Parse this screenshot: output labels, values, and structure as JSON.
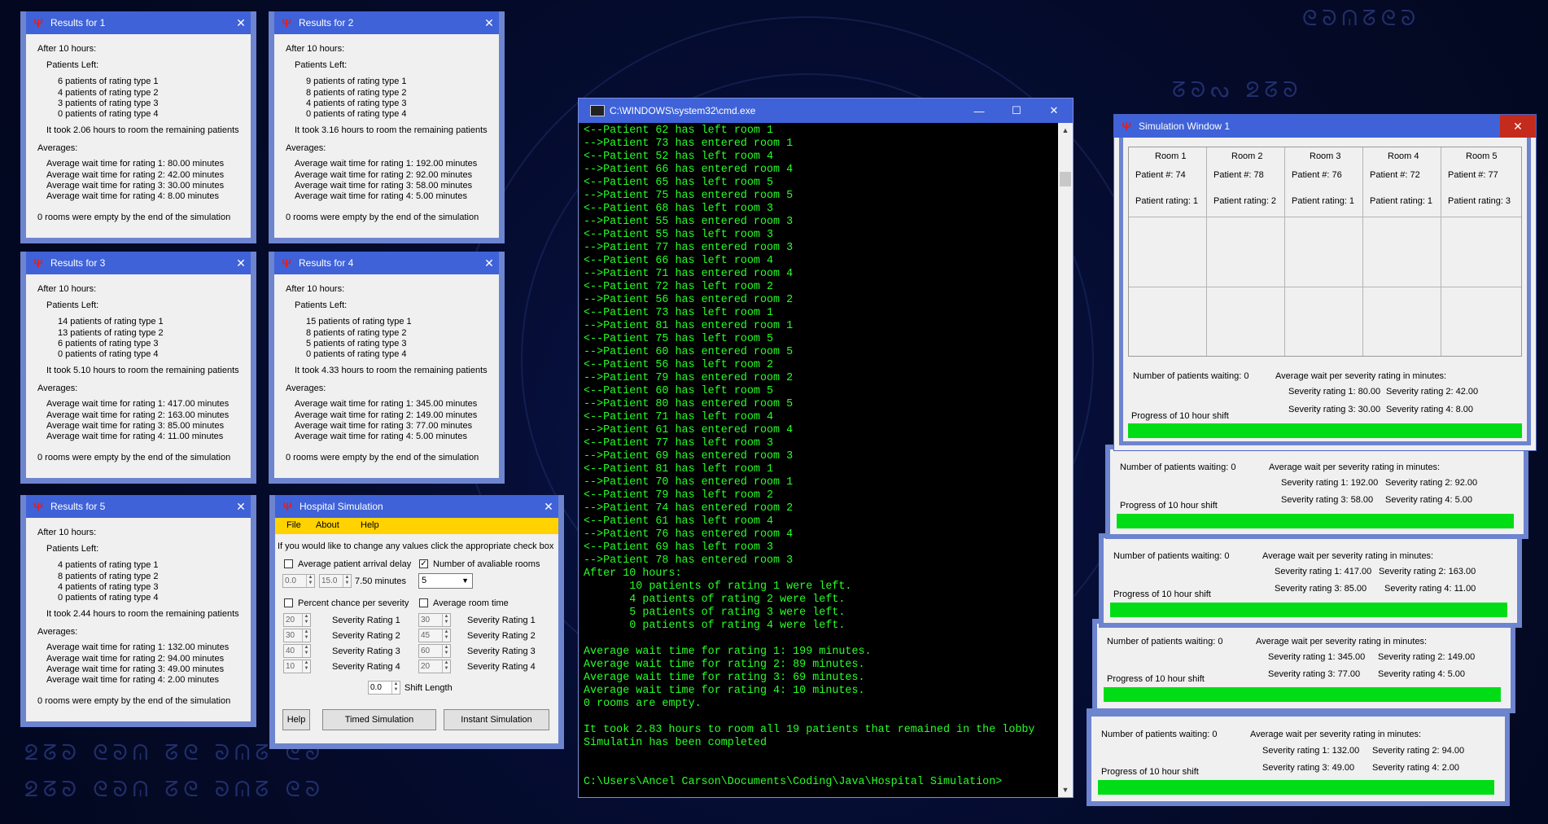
{
  "background": {
    "deco_top": "ᘓᘐᕬᘔᘓᘐ",
    "deco_right": "ᘔᘐᔓ ᘖᘔᘐ",
    "deco_bottom": "ᘖᘔᘐ ᘓᘐᕬ ᘔᘓ ᘐᕬᘔ ᘓᘐ"
  },
  "results": [
    {
      "title": "Results for 1",
      "after": "After 10 hours:",
      "patients_left_label": "Patients Left:",
      "left": [
        "6 patients of rating type 1",
        "4 patients of rating type 2",
        "3 patients of rating type 3",
        "0 patients of rating type 4"
      ],
      "took": "It took 2.06 hours to room the remaining patients",
      "averages_label": "Averages:",
      "averages": [
        "Average wait time for rating 1: 80.00 minutes",
        "Average wait time for rating 2: 42.00 minutes",
        "Average wait time for rating 3: 30.00 minutes",
        "Average wait time for rating 4: 8.00 minutes"
      ],
      "empty": "0 rooms were empty by the end of the simulation"
    },
    {
      "title": "Results for 2",
      "after": "After 10 hours:",
      "patients_left_label": "Patients Left:",
      "left": [
        "9 patients of rating type 1",
        "8 patients of rating type 2",
        "4 patients of rating type 3",
        "0 patients of rating type 4"
      ],
      "took": "It took 3.16 hours to room the remaining patients",
      "averages_label": "Averages:",
      "averages": [
        "Average wait time for rating 1: 192.00 minutes",
        "Average wait time for rating 2: 92.00 minutes",
        "Average wait time for rating 3: 58.00 minutes",
        "Average wait time for rating 4: 5.00 minutes"
      ],
      "empty": "0 rooms were empty by the end of the simulation"
    },
    {
      "title": "Results for 3",
      "after": "After 10 hours:",
      "patients_left_label": "Patients Left:",
      "left": [
        "14 patients of rating type 1",
        "13 patients of rating type 2",
        "6 patients of rating type 3",
        "0 patients of rating type 4"
      ],
      "took": "It took 5.10 hours to room the remaining patients",
      "averages_label": "Averages:",
      "averages": [
        "Average wait time for rating 1: 417.00 minutes",
        "Average wait time for rating 2: 163.00 minutes",
        "Average wait time for rating 3: 85.00 minutes",
        "Average wait time for rating 4: 11.00 minutes"
      ],
      "empty": "0 rooms were empty by the end of the simulation"
    },
    {
      "title": "Results for 4",
      "after": "After 10 hours:",
      "patients_left_label": "Patients Left:",
      "left": [
        "15 patients of rating type 1",
        "8 patients of rating type 2",
        "5 patients of rating type 3",
        "0 patients of rating type 4"
      ],
      "took": "It took 4.33 hours to room the remaining patients",
      "averages_label": "Averages:",
      "averages": [
        "Average wait time for rating 1: 345.00 minutes",
        "Average wait time for rating 2: 149.00 minutes",
        "Average wait time for rating 3: 77.00 minutes",
        "Average wait time for rating 4: 5.00 minutes"
      ],
      "empty": "0 rooms were empty by the end of the simulation"
    },
    {
      "title": "Results for 5",
      "after": "After 10 hours:",
      "patients_left_label": "Patients Left:",
      "left": [
        "4 patients of rating type 1",
        "8 patients of rating type 2",
        "4 patients of rating type 3",
        "0 patients of rating type 4"
      ],
      "took": "It took 2.44 hours to room the remaining patients",
      "averages_label": "Averages:",
      "averages": [
        "Average wait time for rating 1: 132.00 minutes",
        "Average wait time for rating 2: 94.00 minutes",
        "Average wait time for rating 3: 49.00 minutes",
        "Average wait time for rating 4: 2.00 minutes"
      ],
      "empty": "0 rooms were empty by the end of the simulation"
    }
  ],
  "cmd": {
    "title": "C:\\WINDOWS\\system32\\cmd.exe",
    "minimize": "—",
    "maximize": "☐",
    "close": "✕",
    "output": "<--Patient 62 has left room 1\n-->Patient 73 has entered room 1\n<--Patient 52 has left room 4\n-->Patient 66 has entered room 4\n<--Patient 65 has left room 5\n-->Patient 75 has entered room 5\n<--Patient 68 has left room 3\n-->Patient 55 has entered room 3\n<--Patient 55 has left room 3\n-->Patient 77 has entered room 3\n<--Patient 66 has left room 4\n-->Patient 71 has entered room 4\n<--Patient 72 has left room 2\n-->Patient 56 has entered room 2\n<--Patient 73 has left room 1\n-->Patient 81 has entered room 1\n<--Patient 75 has left room 5\n-->Patient 60 has entered room 5\n<--Patient 56 has left room 2\n-->Patient 79 has entered room 2\n<--Patient 60 has left room 5\n-->Patient 80 has entered room 5\n<--Patient 71 has left room 4\n-->Patient 61 has entered room 4\n<--Patient 77 has left room 3\n-->Patient 69 has entered room 3\n<--Patient 81 has left room 1\n-->Patient 70 has entered room 1\n<--Patient 79 has left room 2\n-->Patient 74 has entered room 2\n<--Patient 61 has left room 4\n-->Patient 76 has entered room 4\n<--Patient 69 has left room 3\n-->Patient 78 has entered room 3\nAfter 10 hours:\n       10 patients of rating 1 were left.\n       4 patients of rating 2 were left.\n       5 patients of rating 3 were left.\n       0 patients of rating 4 were left.\n\nAverage wait time for rating 1: 199 minutes.\nAverage wait time for rating 2: 89 minutes.\nAverage wait time for rating 3: 69 minutes.\nAverage wait time for rating 4: 10 minutes.\n0 rooms are empty.\n\nIt took 2.83 hours to room all 19 patients that remained in the lobby\nSimulatin has been completed\n\n\nC:\\Users\\Ancel Carson\\Documents\\Coding\\Java\\Hospital Simulation>"
  },
  "sim_window": {
    "title": "Simulation Window 1",
    "close": "✕",
    "rooms": [
      {
        "name": "Room 1",
        "patient": "Patient #: 74",
        "rating": "Patient rating: 1"
      },
      {
        "name": "Room 2",
        "patient": "Patient #: 78",
        "rating": "Patient rating: 2"
      },
      {
        "name": "Room 3",
        "patient": "Patient #: 76",
        "rating": "Patient rating: 1"
      },
      {
        "name": "Room 4",
        "patient": "Patient #: 72",
        "rating": "Patient rating: 1"
      },
      {
        "name": "Room 5",
        "patient": "Patient #: 77",
        "rating": "Patient rating: 3"
      }
    ],
    "waiting": "Number of patients waiting: 0",
    "avg_label": "Average wait per severity rating in minutes:",
    "sev1": "Severity rating 1: 80.00",
    "sev2": "Severity rating 2: 42.00",
    "sev3": "Severity rating 3: 30.00",
    "sev4": "Severity rating 4: 8.00",
    "progress_label": "Progress of 10 hour shift",
    "progress": 1.0
  },
  "stacked_sims": [
    {
      "waiting": "Number of patients waiting: 0",
      "avg_label": "Average wait per severity rating in minutes:",
      "sev1": "Severity rating 1: 192.00",
      "sev2": "Severity rating 2: 92.00",
      "sev3": "Severity rating 3: 58.00",
      "sev4": "Severity rating 4: 5.00",
      "progress_label": "Progress of 10 hour shift",
      "progress": 1.0
    },
    {
      "waiting": "Number of patients waiting: 0",
      "avg_label": "Average wait per severity rating in minutes:",
      "sev1": "Severity rating 1: 417.00",
      "sev2": "Severity rating 2: 163.00",
      "sev3": "Severity rating 3: 85.00",
      "sev4": "Severity rating 4: 11.00",
      "progress_label": "Progress of 10 hour shift",
      "progress": 1.0
    },
    {
      "waiting": "Number of patients waiting: 0",
      "avg_label": "Average wait per severity rating in minutes:",
      "sev1": "Severity rating 1: 345.00",
      "sev2": "Severity rating 2: 149.00",
      "sev3": "Severity rating 3: 77.00",
      "sev4": "Severity rating 4: 5.00",
      "progress_label": "Progress of 10 hour shift",
      "progress": 1.0
    },
    {
      "waiting": "Number of patients waiting: 0",
      "avg_label": "Average wait per severity rating in minutes:",
      "sev1": "Severity rating 1: 132.00",
      "sev2": "Severity rating 2: 94.00",
      "sev3": "Severity rating 3: 49.00",
      "sev4": "Severity rating 4: 2.00",
      "progress_label": "Progress of 10 hour shift",
      "progress": 1.0
    }
  ],
  "hospital": {
    "title": "Hospital Simulation",
    "close": "✕",
    "menu": [
      "File",
      "About",
      "Help"
    ],
    "instruction": "If you would like to change any values click the appropriate check box",
    "arrival_label": "Average patient arrival delay",
    "arrival_min": "0.0",
    "arrival_max": "15.0",
    "arrival_value": "7.50 minutes",
    "rooms_label": "Number of avaliable rooms",
    "rooms_value": "5",
    "percent_label": "Percent chance per severity",
    "percent_values": [
      "20",
      "30",
      "40",
      "10"
    ],
    "room_time_label": "Average room time",
    "room_time_values": [
      "30",
      "45",
      "60",
      "20"
    ],
    "severity_labels": [
      "Severity Rating 1",
      "Severity Rating 2",
      "Severity Rating 3",
      "Severity Rating 4"
    ],
    "shift_value": "0.0",
    "shift_label": "Shift Length",
    "help_button": "Help",
    "timed_button": "Timed Simulation",
    "instant_button": "Instant Simulation"
  },
  "colors": {
    "titlebar": "#3f62d8",
    "frame": "#6d84cf",
    "terminal_text": "#27ff27",
    "menubar": "#ffd200",
    "progress": "#00dd16"
  }
}
